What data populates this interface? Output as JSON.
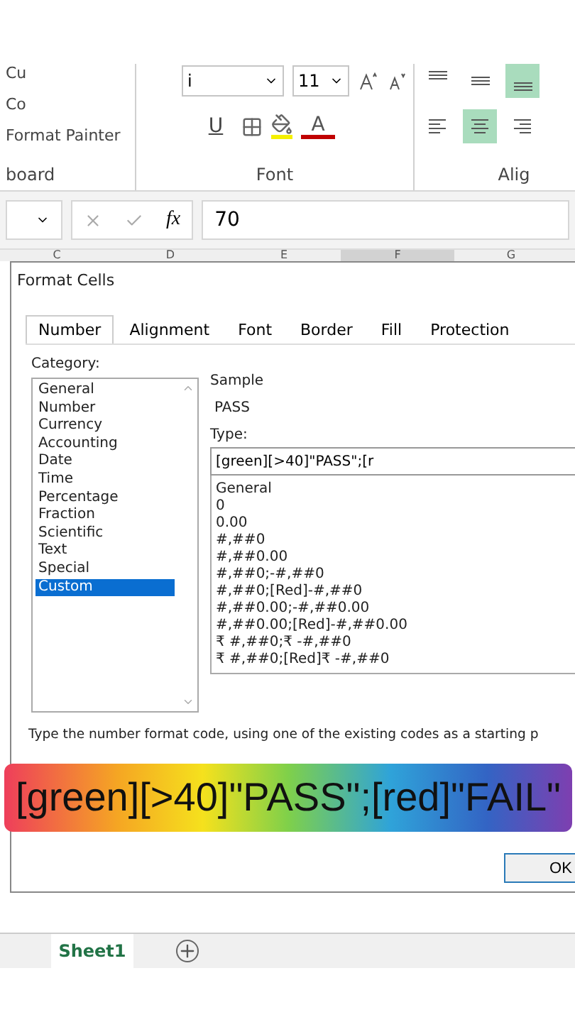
{
  "ribbon": {
    "clipboard": {
      "items": [
        "Cu",
        "Co",
        "Format Painter"
      ],
      "label": "board"
    },
    "font": {
      "font_name": "i",
      "font_size": "11",
      "underline": "U",
      "font_color_letter": "A",
      "label": "Font"
    },
    "alignment": {
      "label": "Alig",
      "vertical": [
        {
          "kind": "top",
          "selected": false
        },
        {
          "kind": "middle",
          "selected": false
        },
        {
          "kind": "bottom",
          "selected": true
        }
      ],
      "horizontal": [
        {
          "kind": "left",
          "selected": false
        },
        {
          "kind": "center",
          "selected": true
        },
        {
          "kind": "right",
          "selected": false
        }
      ]
    }
  },
  "formula_bar": {
    "fx": "fx",
    "value": "70"
  },
  "column_headers": [
    {
      "label": "C",
      "selected": false
    },
    {
      "label": "D",
      "selected": false
    },
    {
      "label": "E",
      "selected": false
    },
    {
      "label": "F",
      "selected": true
    },
    {
      "label": "G",
      "selected": false
    }
  ],
  "dialog": {
    "title": "Format Cells",
    "tabs": [
      {
        "label": "Number",
        "selected": true
      },
      {
        "label": "Alignment",
        "selected": false
      },
      {
        "label": "Font",
        "selected": false
      },
      {
        "label": "Border",
        "selected": false
      },
      {
        "label": "Fill",
        "selected": false
      },
      {
        "label": "Protection",
        "selected": false
      }
    ],
    "category_label": "Category:",
    "categories": [
      {
        "label": "General",
        "selected": false
      },
      {
        "label": "Number",
        "selected": false
      },
      {
        "label": "Currency",
        "selected": false
      },
      {
        "label": "Accounting",
        "selected": false
      },
      {
        "label": "Date",
        "selected": false
      },
      {
        "label": "Time",
        "selected": false
      },
      {
        "label": "Percentage",
        "selected": false
      },
      {
        "label": "Fraction",
        "selected": false
      },
      {
        "label": "Scientific",
        "selected": false
      },
      {
        "label": "Text",
        "selected": false
      },
      {
        "label": "Special",
        "selected": false
      },
      {
        "label": "Custom",
        "selected": true
      }
    ],
    "sample_label": "Sample",
    "sample_value": "PASS",
    "type_label": "Type:",
    "type_value": "[green][>40]\"PASS\";[r",
    "formats": [
      "General",
      "0",
      "0.00",
      "#,##0",
      "#,##0.00",
      "#,##0;-#,##0",
      "#,##0;[Red]-#,##0",
      "#,##0.00;-#,##0.00",
      "#,##0.00;[Red]-#,##0.00",
      "₹ #,##0;₹ -#,##0",
      "₹ #,##0;[Red]₹ -#,##0"
    ],
    "hint": "Type the number format code, using one of the existing codes as a starting p",
    "ok_button": "OK"
  },
  "caption_banner": "[green][>40]\"PASS\";[red]\"FAIL\"",
  "sheet_tabs": [
    {
      "label": "Sheet1",
      "selected": true
    }
  ]
}
